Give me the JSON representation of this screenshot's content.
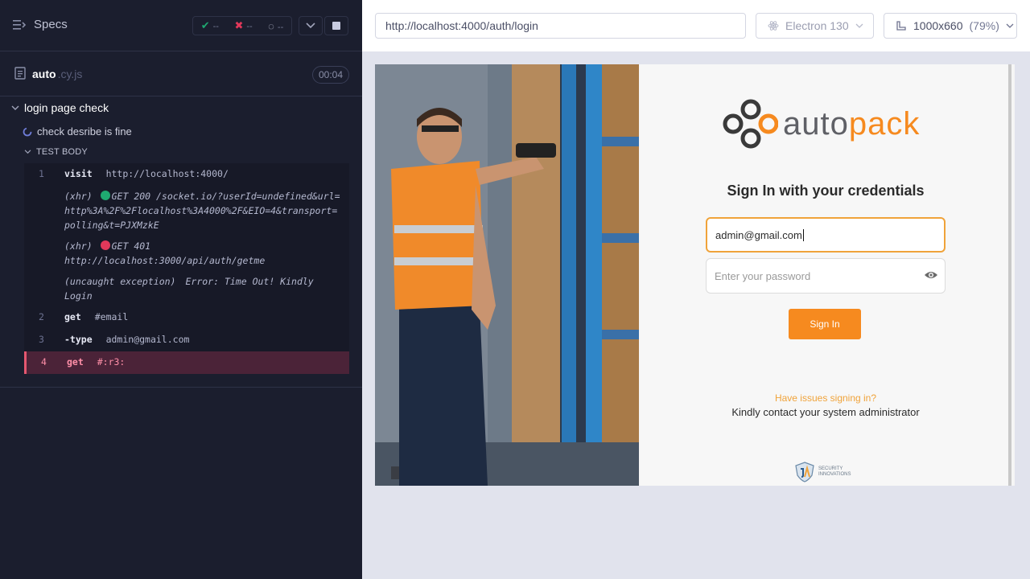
{
  "reporter": {
    "specs_label": "Specs",
    "stats": {
      "passed": "--",
      "failed": "--",
      "pending": "--"
    },
    "spec": {
      "name": "auto",
      "ext": ".cy.js",
      "duration": "00:04"
    },
    "suite_title": "login page check",
    "test_title": "check desribe is fine",
    "test_body_label": "TEST BODY",
    "commands": [
      {
        "num": "1",
        "name": "visit",
        "message": "http://localhost:4000/"
      },
      {
        "type": "xhr",
        "prefix": "(xhr)",
        "status_color": "#1fa971",
        "text": "GET 200 /socket.io/?userId=undefined&url=http%3A%2F%2Flocalhost%3A4000%2F&EIO=4&transport=polling&t=PJXMzkE"
      },
      {
        "type": "xhr",
        "prefix": "(xhr)",
        "status_color": "#e2385a",
        "text": "GET 401 http://localhost:3000/api/auth/getme"
      },
      {
        "type": "exception",
        "prefix": "(uncaught exception)",
        "text": "Error: Time Out! Kindly Login"
      },
      {
        "num": "2",
        "name": "get",
        "message": "#email"
      },
      {
        "num": "3",
        "name": "-type",
        "message": "admin@gmail.com"
      },
      {
        "num": "4",
        "name": "get",
        "message": "#:r3:",
        "state": "failed"
      }
    ]
  },
  "topbar": {
    "url": "http://localhost:4000/auth/login",
    "browser": "Electron 130",
    "viewport": "1000x660",
    "zoom": "(79%)"
  },
  "app": {
    "logo_text_a": "auto",
    "logo_text_b": "pack",
    "title": "Sign In with your credentials",
    "email_value": "admin@gmail.com",
    "password_placeholder": "Enter your password",
    "signin_label": "Sign In",
    "issues_link": "Have issues signing in?",
    "contact_text": "Kindly contact your system administrator",
    "footer_logo_line1": "SECURITY",
    "footer_logo_line2": "INNOVATIONS",
    "accent_color": "#f68a1f"
  }
}
